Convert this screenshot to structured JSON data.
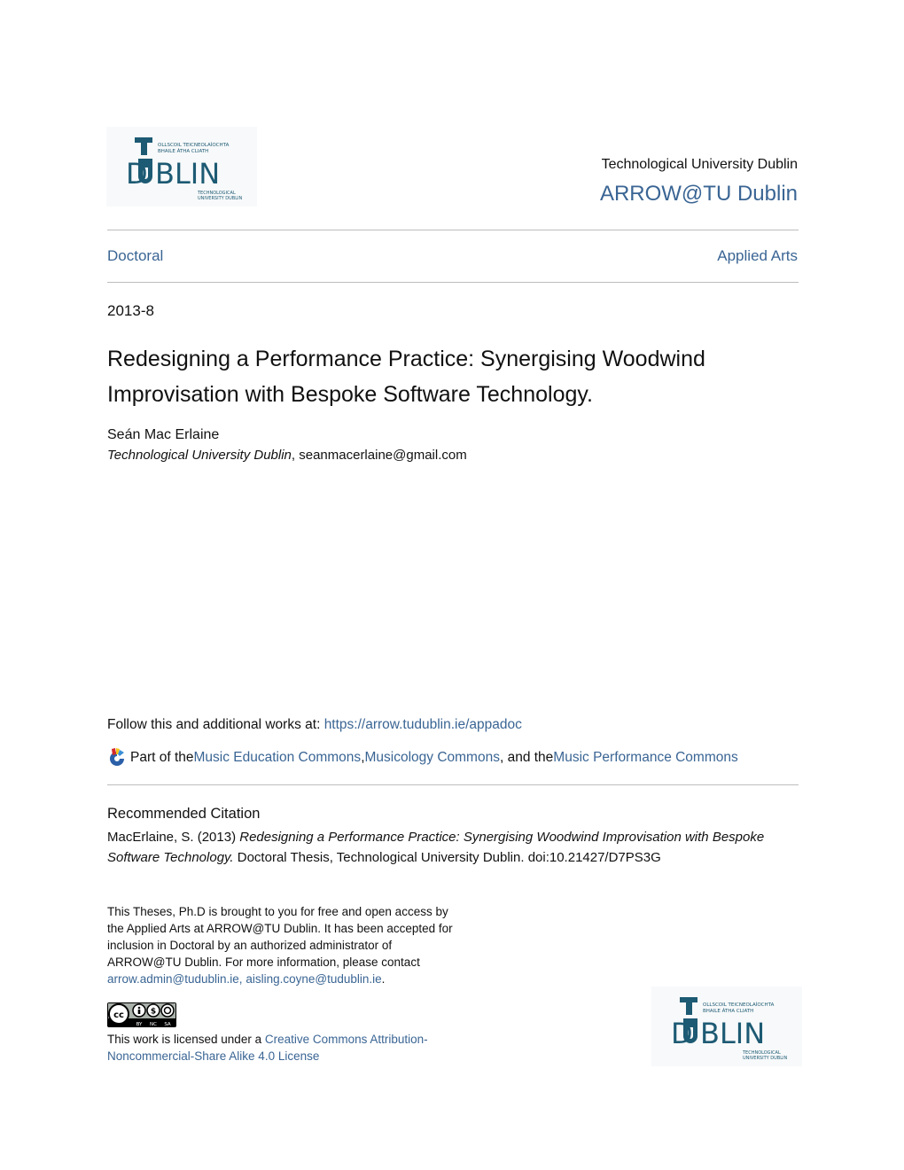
{
  "header": {
    "logo_text": {
      "irish_line1": "OLLSCOIL TEICNEOLAÍOCHTA",
      "irish_line2": "BHAILE ÁTHA CLIATH",
      "wordmark": "DUBLIN",
      "english_line1": "TECHNOLOGICAL",
      "english_line2": "UNIVERSITY DUBLIN"
    },
    "institution": "Technological University Dublin",
    "repository": "ARROW@TU Dublin"
  },
  "nav": {
    "series": "Doctoral",
    "department": "Applied Arts"
  },
  "document": {
    "date": "2013-8",
    "title": "Redesigning a Performance Practice: Synergising Woodwind Improvisation with Bespoke Software Technology.",
    "author": "Seán Mac Erlaine",
    "affiliation": "Technological University Dublin",
    "separator": ", ",
    "email": "seanmacerlaine@gmail.com"
  },
  "links": {
    "follow_prefix": "Follow this and additional works at: ",
    "follow_url": "https://arrow.tudublin.ie/appadoc",
    "partof_prefix": "Part of the ",
    "commons": [
      "Music Education Commons",
      "Musicology Commons",
      "Music Performance Commons"
    ],
    "comma": ", ",
    "and_the": ", and the "
  },
  "citation": {
    "heading": "Recommended Citation",
    "prefix": "MacErlaine, S. (2013) ",
    "title_italic": "Redesigning a Performance Practice: Synergising Woodwind Improvisation with Bespoke Software Technology.",
    "suffix": " Doctoral Thesis, Technological University Dublin. doi:10.21427/D7PS3G"
  },
  "notice": {
    "text": "This Theses, Ph.D is brought to you for free and open access by the Applied Arts at ARROW@TU Dublin. It has been accepted for inclusion in Doctoral by an authorized administrator of ARROW@TU Dublin. For more information, please contact ",
    "email1": "arrow.admin@tudublin.ie,",
    "space": " ",
    "email2": "aisling.coyne@tudublin.ie",
    "period": "."
  },
  "cc_badge": {
    "labels": [
      "BY",
      "NC",
      "SA"
    ]
  },
  "license": {
    "prefix": "This work is licensed under a ",
    "link": "Creative Commons Attribution-Noncommercial-Share Alike 4.0 License"
  },
  "colors": {
    "link": "#3a6594",
    "logo": "#1d5a73",
    "divider": "#bdbdbd"
  }
}
